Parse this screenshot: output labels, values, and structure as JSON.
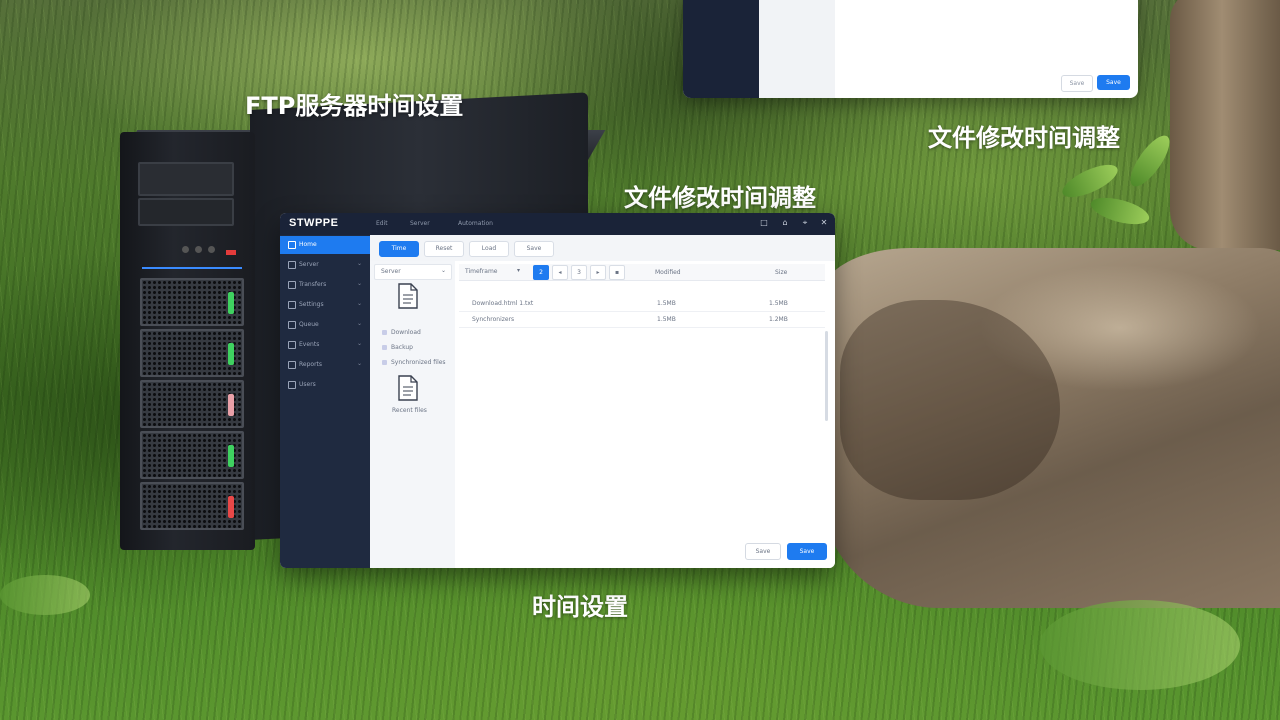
{
  "captions": {
    "server_title": "FTP服务器时间设置",
    "window_title": "文件修改时间调整",
    "back_panel_title": "文件修改时间调整",
    "bottom_title": "时间设置"
  },
  "back_panel": {
    "cancel_label": "Save",
    "primary_label": "Save"
  },
  "window": {
    "logo": "STWPPE",
    "menu": [
      "Edit",
      "Server",
      "Automation"
    ],
    "controls": [
      "□",
      "⌂",
      "⌖",
      "✕"
    ],
    "sidebar": [
      {
        "label": "Home",
        "active": true
      },
      {
        "label": "Server"
      },
      {
        "label": "Transfers"
      },
      {
        "label": "Settings"
      },
      {
        "label": "Queue"
      },
      {
        "label": "Events"
      },
      {
        "label": "Reports"
      },
      {
        "label": "Users"
      }
    ],
    "toolbar": [
      "Time",
      "Reset",
      "Load",
      "Save"
    ],
    "tree": {
      "header": "Server",
      "rows": [
        "Download",
        "Backup",
        "Synchronized files"
      ],
      "second_doc_label": "Recent files"
    },
    "filter": {
      "select_value": "Timeframe",
      "pages": [
        "2",
        "◂",
        "3",
        "▸",
        "▪"
      ],
      "columns": [
        "Modified",
        "Size"
      ]
    },
    "rows": [
      {
        "name": "Download.html 1.txt",
        "modified": "1.5MB",
        "size": "1.5MB"
      },
      {
        "name": "Synchronizers",
        "modified": "1.5MB",
        "size": "1.2MB"
      }
    ],
    "footer": {
      "cancel_label": "Save",
      "save_label": "Save"
    }
  },
  "colors": {
    "accent": "#1e7bf0",
    "titlebar": "#1a2338",
    "sidebar": "#1f2a40"
  }
}
